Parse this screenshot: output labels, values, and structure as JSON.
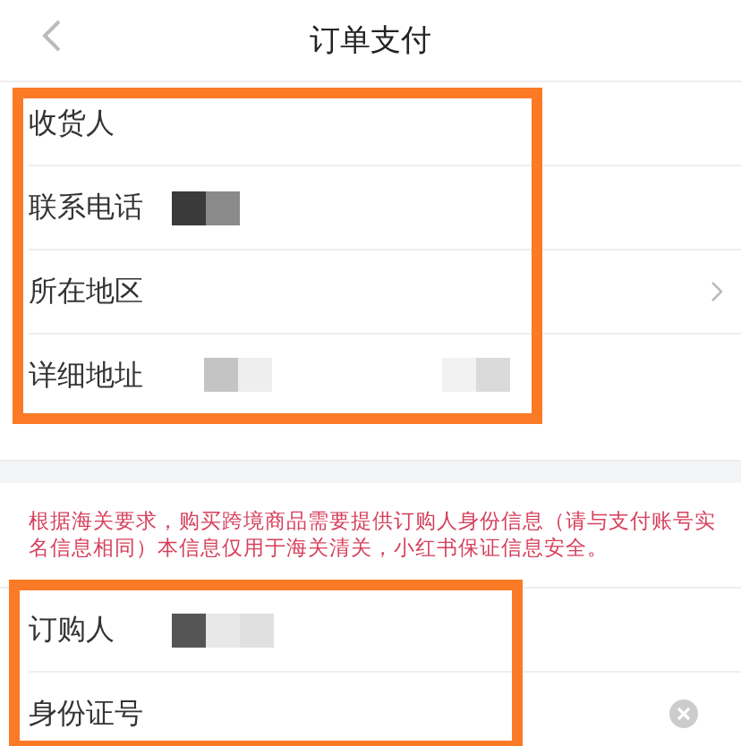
{
  "header": {
    "title": "订单支付"
  },
  "address_section": {
    "highlighted": true,
    "rows": [
      {
        "label": "收货人",
        "masked": false,
        "kind": "plain"
      },
      {
        "label": "联系电话",
        "masked": true,
        "kind": "plain"
      },
      {
        "label": "所在地区",
        "masked": false,
        "kind": "chooser"
      },
      {
        "label": "详细地址",
        "masked": true,
        "kind": "plain"
      }
    ]
  },
  "notice": "根据海关要求，购买跨境商品需要提供订购人身份信息（请与支付账号实名信息相同）本信息仅用于海关清关，小红书保证信息安全。",
  "buyer_section": {
    "highlighted": true,
    "rows": [
      {
        "label": "订购人",
        "masked": true,
        "kind": "plain"
      },
      {
        "label": "身份证号",
        "masked": false,
        "kind": "clearable"
      }
    ]
  }
}
